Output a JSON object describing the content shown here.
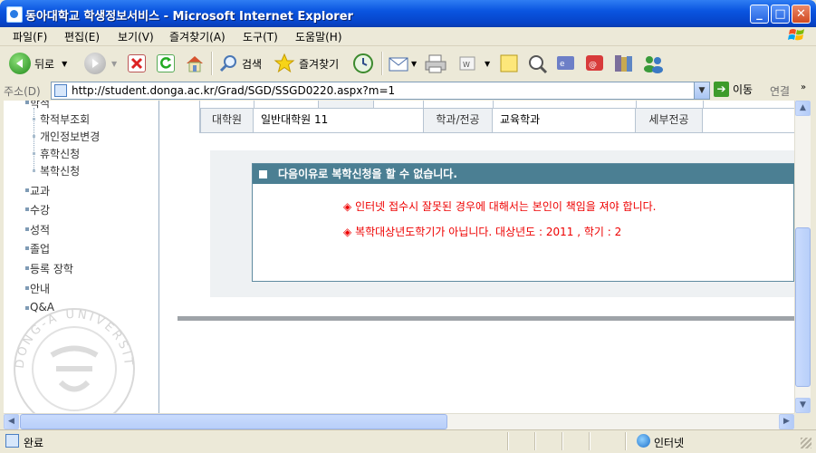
{
  "window": {
    "title": "동아대학교 학생정보서비스 - Microsoft Internet Explorer",
    "minimize": "_",
    "maximize": "□",
    "close": "✕"
  },
  "menu": [
    "파일(F)",
    "편집(E)",
    "보기(V)",
    "즐겨찾기(A)",
    "도구(T)",
    "도움말(H)"
  ],
  "toolbar": {
    "back_label": "뒤로",
    "search_label": "검색",
    "favorites_label": "즐겨찾기",
    "icons": [
      "back-icon",
      "forward-icon",
      "stop-icon",
      "refresh-icon",
      "home-icon",
      "search-icon",
      "favorites-icon",
      "history-icon",
      "mail-icon",
      "print-icon",
      "edit-icon",
      "note-icon",
      "research-icon",
      "messenger-icon",
      "translate-icon",
      "media-icon",
      "people-icon"
    ]
  },
  "address": {
    "label": "주소(D)",
    "url": "http://student.donga.ac.kr/Grad/SGD/SSGD0220.aspx?m=1",
    "go_label": "이동",
    "links_label": "연결"
  },
  "sidebar": {
    "partial_top": "학적",
    "sub_items": [
      "학적부조회",
      "개인정보변경",
      "휴학신청",
      "복학신청"
    ],
    "top_items": [
      "교과",
      "수강",
      "성적",
      "졸업",
      "등록 장학",
      "안내",
      "Q&A"
    ],
    "watermark_text": "DONG-A UNIVERSITY"
  },
  "info_table": {
    "grad_school_label": "대학원",
    "grad_school_value": "일반대학원 11",
    "dept_label": "학과/전공",
    "dept_value": "교육학과",
    "major_label": "세부전공",
    "major_value": ""
  },
  "message": {
    "header": "다음이유로 복학신청을 할 수 없습니다.",
    "lines": [
      "인터넷 접수시 잘못된 경우에 대해서는 본인이 책임을 져야 합니다.",
      "복학대상년도학기가 아닙니다. 대상년도 : 2011 , 학기 : 2"
    ],
    "bullet": "◈"
  },
  "status": {
    "text": "완료",
    "zone": "인터넷"
  }
}
